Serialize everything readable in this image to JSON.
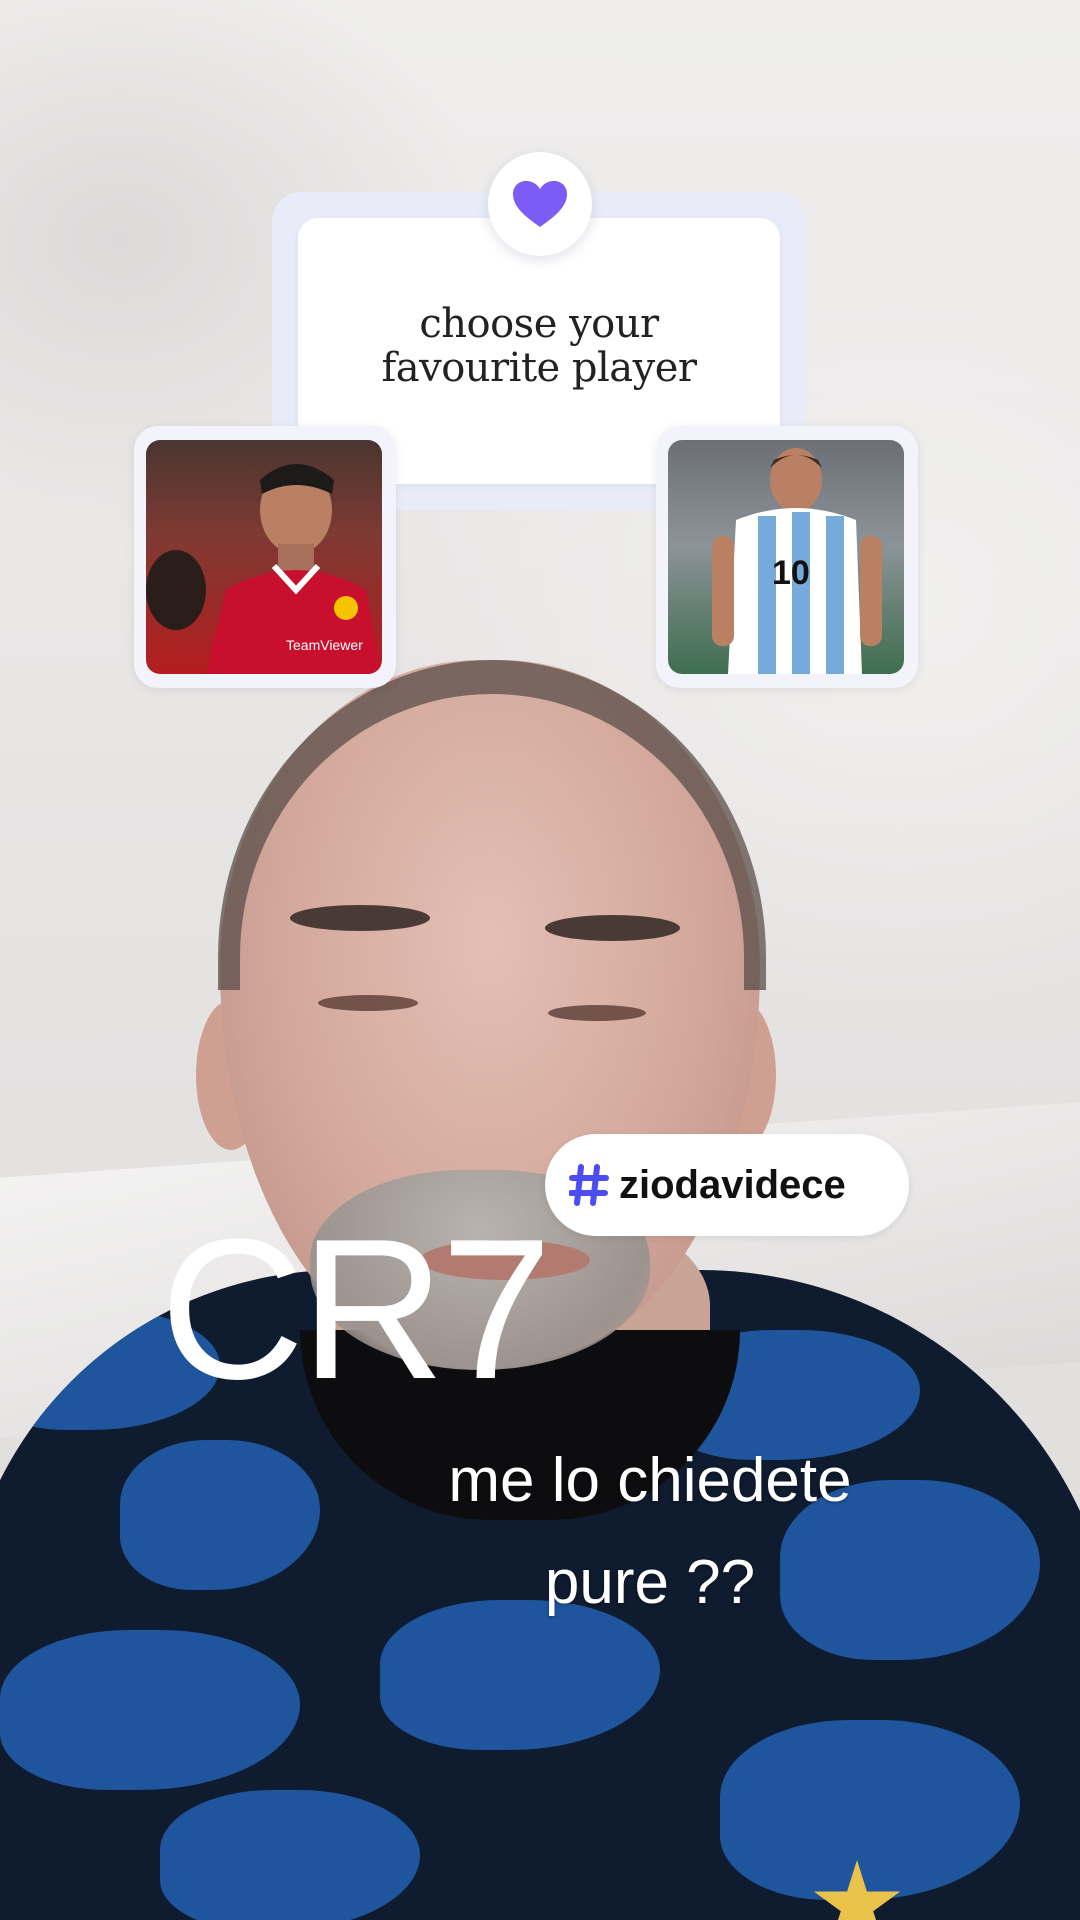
{
  "poll": {
    "title_line1": "choose your",
    "title_line2": "favourite player",
    "heart_color": "#7c5cf5",
    "options": [
      {
        "name": "player-option-left",
        "kit_color": "#c8102e"
      },
      {
        "name": "player-option-right",
        "kit_color": "#75aadb"
      }
    ]
  },
  "hashtag": {
    "symbol": "#",
    "text": "ziodavidece",
    "symbol_color": "#4b4ef0"
  },
  "overlay": {
    "headline": "CR7",
    "caption_line1": "me lo chiedete",
    "caption_line2": "pure ??"
  },
  "jersey": {
    "ronaldo_sponsor": "TeamViewer",
    "messi_number": "10"
  }
}
